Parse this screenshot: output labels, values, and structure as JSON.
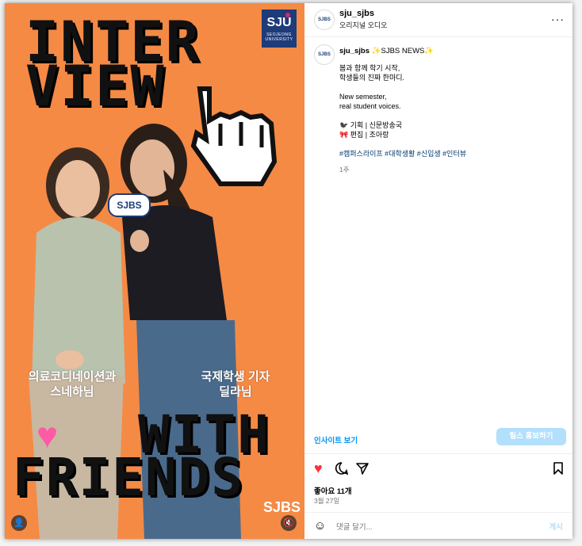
{
  "media": {
    "title_line1": "INTER",
    "title_line2": "VIEW",
    "bottom_line1": "WITH",
    "bottom_line2": "FRIENDS",
    "logo_big": "SJU",
    "logo_small": "SEOJEONG UNIVERSITY",
    "person1_caption_line1": "의료코디네이션과",
    "person1_caption_line2": "스네하님",
    "person2_caption_line1": "국제학생 기자",
    "person2_caption_line2": "딜라님",
    "mic_label": "SJBS",
    "bottom_logo": "SJBS",
    "colors": {
      "background": "#f58a45",
      "logo": "#1e3b7a",
      "heart": "#ff5aa5"
    }
  },
  "header": {
    "avatar_text": "SJBS",
    "username": "sju_sjbs",
    "subtitle": "오리지널 오디오",
    "more_icon": "···"
  },
  "post": {
    "avatar_text": "SJBS",
    "username": "sju_sjbs",
    "title": " ✨SJBS NEWS✨",
    "line1": "봄과 함께 학기 시작,",
    "line2": "학생들의 진짜 한마디.",
    "line3": "New semester,",
    "line4": "real student voices.",
    "credit1": "🐦‍⬛ 기획 | 신문방송국",
    "credit2": "🎀 편집 | 조아랑",
    "hashtags": "#캠퍼스라이프 #대학생활 #신입생 #인터뷰",
    "age": "1주"
  },
  "footer": {
    "insights_label": "인사이트 보기",
    "boost_label": "릴스 홍보하기",
    "likes": "좋아요 11개",
    "date": "3월 27일",
    "comment_placeholder": "댓글 달기...",
    "post_label": "게시"
  }
}
